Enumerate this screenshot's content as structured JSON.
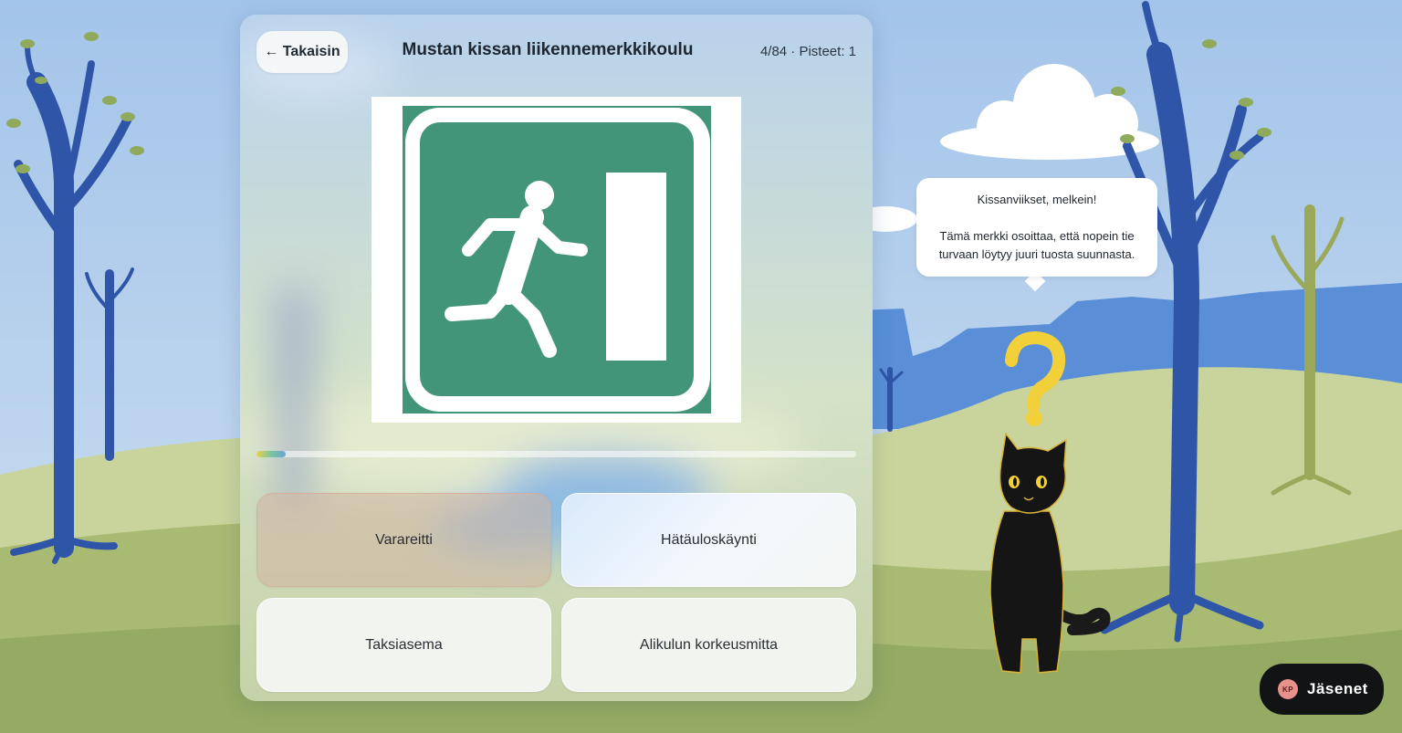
{
  "header": {
    "back_label": "← Takaisin",
    "title": "Mustan kissan liikennemerkkikoulu",
    "score": "4/84 · Pisteet: 1"
  },
  "progress": {
    "current": 4,
    "total": 84,
    "fraction": 0.048
  },
  "sign": {
    "icon": "emergency-exit-sign",
    "color": "#43957a"
  },
  "answers": [
    {
      "label": "Varareitti",
      "state": "wrong"
    },
    {
      "label": "Hätäuloskäynti",
      "state": "hover"
    },
    {
      "label": "Taksiasema",
      "state": "default"
    },
    {
      "label": "Alikulun korkeusmitta",
      "state": "default"
    }
  ],
  "speech": {
    "line1": "Kissanviikset, melkein!",
    "line2": "Tämä merkki osoittaa, että nopein tie turvaan löytyy juuri tuosta suunnasta."
  },
  "member": {
    "initials": "KP",
    "label": "Jäsenet"
  },
  "colors": {
    "sky": "#a9c8e8",
    "tree_blue": "#2f55a8",
    "tree_olive": "#9aa85a",
    "grass": "#a8b870",
    "question_mark": "#f2d03a"
  }
}
